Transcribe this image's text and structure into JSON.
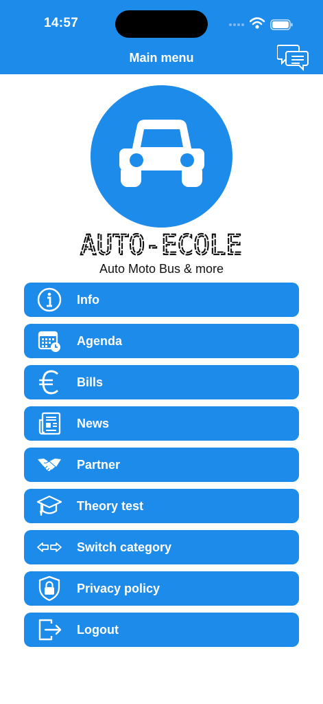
{
  "status_bar": {
    "time": "14:57"
  },
  "header": {
    "title": "Main menu",
    "chat_icon": "chat-bubbles-icon"
  },
  "brand": {
    "logo_icon": "car-icon",
    "name": "AUTO-ECOLE",
    "tagline": "Auto Moto Bus & more"
  },
  "menu": [
    {
      "label": "Info",
      "icon": "info-icon"
    },
    {
      "label": "Agenda",
      "icon": "calendar-clock-icon"
    },
    {
      "label": "Bills",
      "icon": "euro-icon"
    },
    {
      "label": "News",
      "icon": "newspaper-icon"
    },
    {
      "label": "Partner",
      "icon": "handshake-icon"
    },
    {
      "label": "Theory test",
      "icon": "graduation-cap-icon"
    },
    {
      "label": "Switch category",
      "icon": "switch-arrows-icon"
    },
    {
      "label": "Privacy policy",
      "icon": "shield-lock-icon"
    },
    {
      "label": "Logout",
      "icon": "logout-icon"
    }
  ],
  "colors": {
    "primary": "#1d8bea",
    "background": "#ffffff",
    "text": "#111111"
  }
}
